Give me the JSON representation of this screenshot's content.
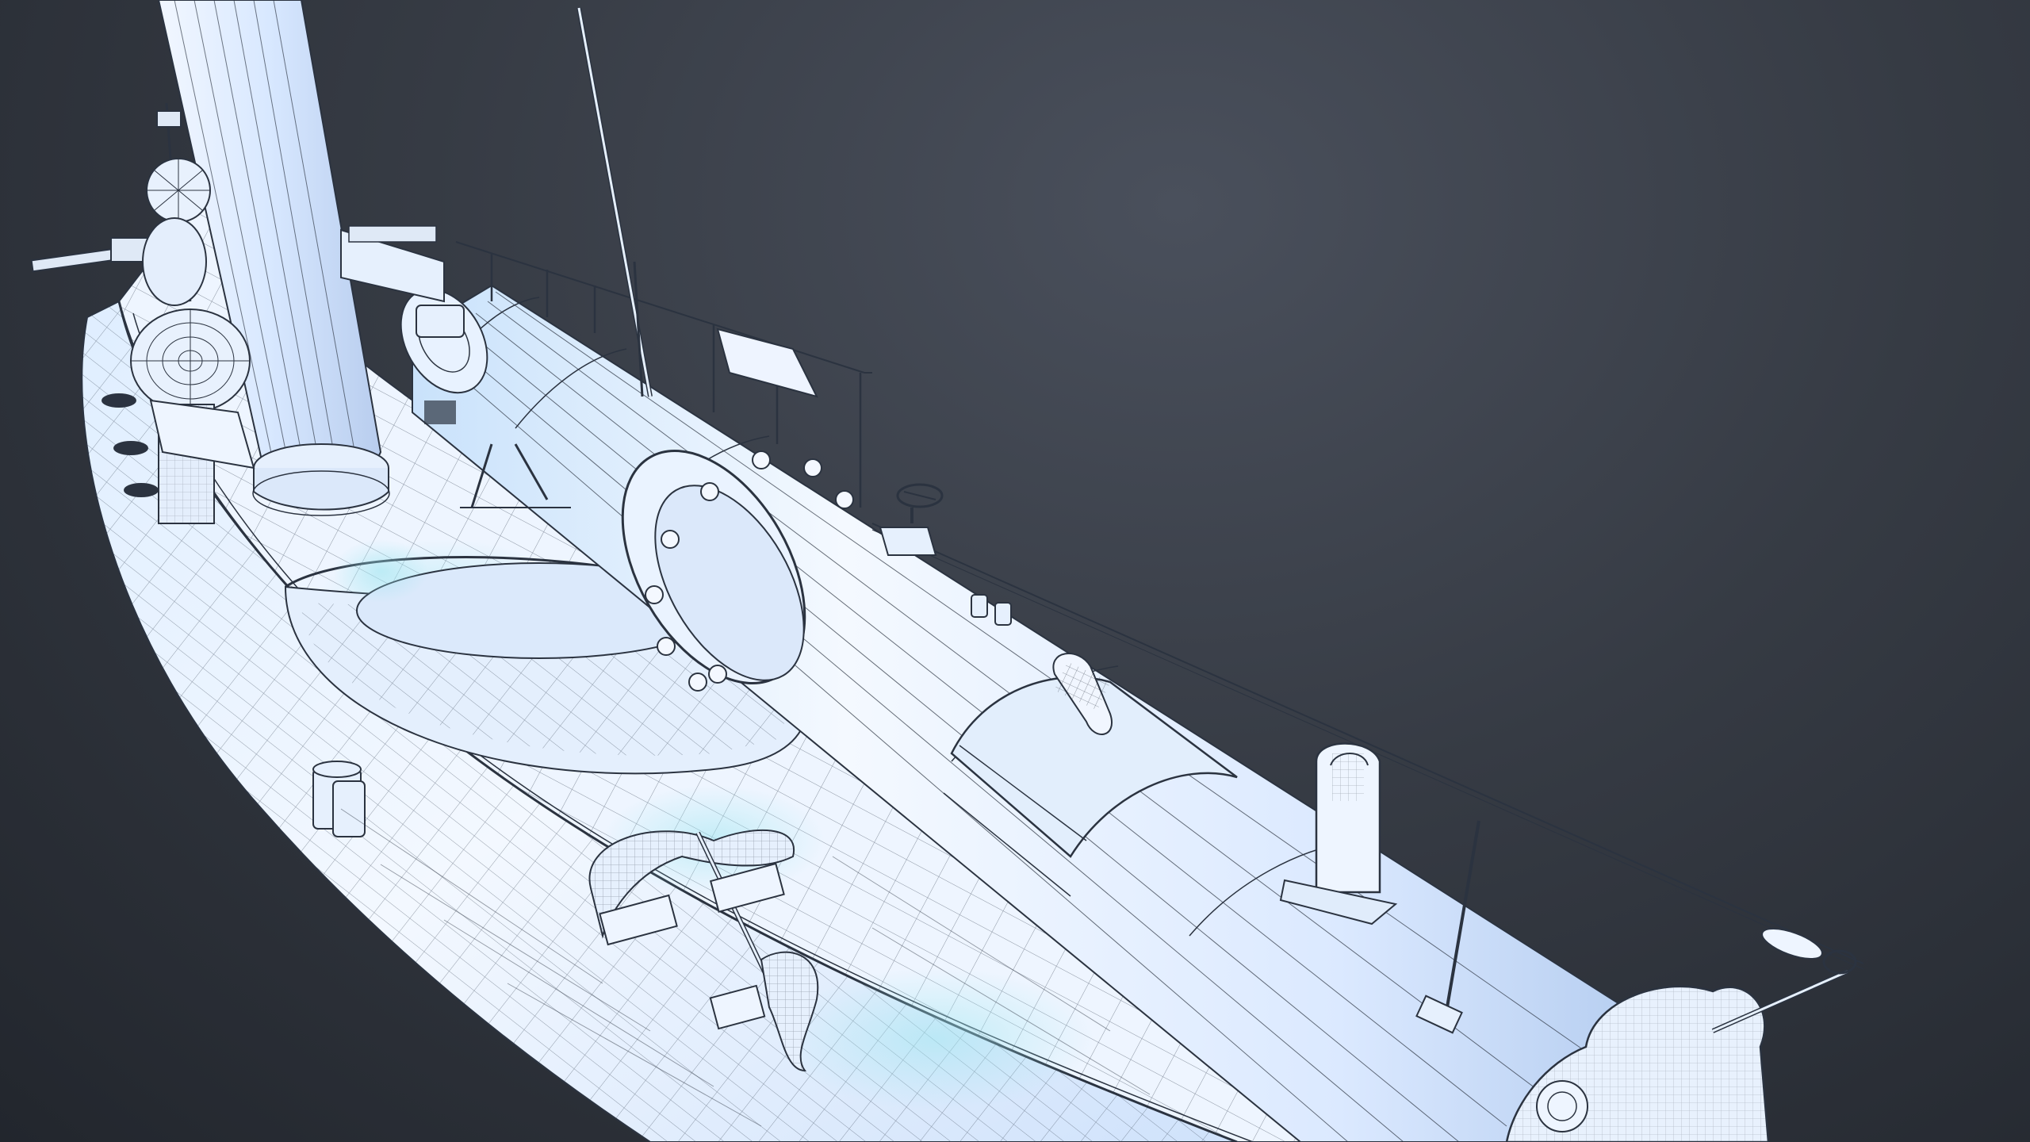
{
  "scene": {
    "subject": "",
    "colors": {
      "background_top": "#4a505c",
      "background_bottom": "#22262d",
      "mesh_fill": "#e9f2ff",
      "mesh_shadow": "#b9d6f2",
      "wire": "#2b3340",
      "accent_cyan": "#9fe6f0"
    }
  }
}
